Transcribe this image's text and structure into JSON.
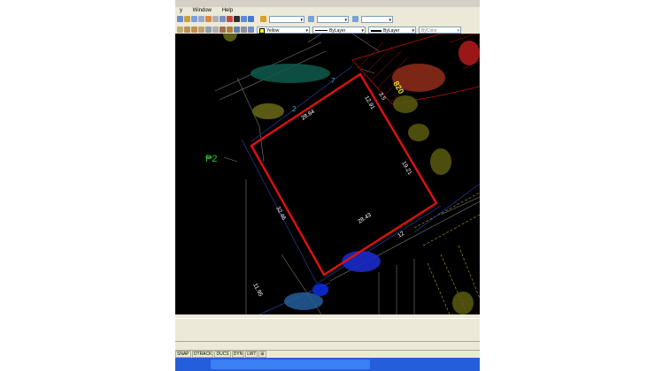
{
  "menu": {
    "items": [
      "y",
      "Window",
      "Help"
    ]
  },
  "toolbar": {
    "color_value": "Yellow",
    "linetype_value": "ByLayer",
    "lineweight_value": "ByLayer",
    "plotstyle_value": "ByColor"
  },
  "drawing": {
    "parcel_id": "₱2",
    "dimensions": [
      "28.84",
      "12.91",
      "3.5",
      "19.21",
      "28.43",
      "32.46",
      "12",
      "11.95"
    ],
    "label_7": "7",
    "label_2": "2",
    "label_820": "820"
  },
  "status": {
    "buttons": [
      "SNAP",
      "OTRACK",
      "DUCS",
      "DYN",
      "LWT",
      "⊞"
    ]
  },
  "colors": {
    "background": "#000000",
    "parcel_outline": "#e01010",
    "dimension_text": "#ffffff",
    "grid_lines": "#7a7a7a"
  }
}
